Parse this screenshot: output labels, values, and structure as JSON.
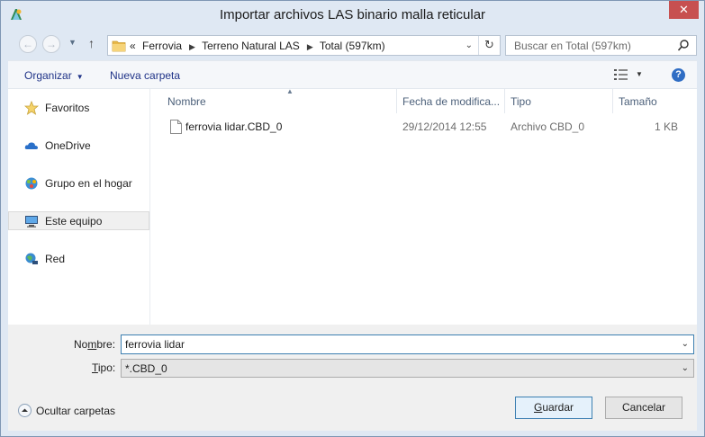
{
  "window": {
    "title": "Importar archivos LAS binario malla reticular",
    "close_symbol": "✕"
  },
  "navbar": {
    "back_symbol": "←",
    "forward_symbol": "→",
    "up_symbol": "↑",
    "breadcrumb_prefix": "«",
    "breadcrumbs": [
      "Ferrovia",
      "Terreno Natural LAS",
      "Total (597km)"
    ],
    "refresh_symbol": "↻"
  },
  "search": {
    "placeholder": "Buscar en Total (597km)"
  },
  "toolbar": {
    "organize_label": "Organizar",
    "new_folder_label": "Nueva carpeta",
    "help_symbol": "?"
  },
  "sidebar": {
    "items": [
      {
        "label": "Favoritos",
        "icon": "star-icon"
      },
      {
        "label": "OneDrive",
        "icon": "cloud-icon"
      },
      {
        "label": "Grupo en el hogar",
        "icon": "homegroup-icon"
      },
      {
        "label": "Este equipo",
        "icon": "computer-icon",
        "selected": true
      },
      {
        "label": "Red",
        "icon": "network-icon"
      }
    ]
  },
  "file_list": {
    "columns": [
      "Nombre",
      "Fecha de modifica...",
      "Tipo",
      "Tamaño"
    ],
    "rows": [
      {
        "name": "ferrovia lidar.CBD_0",
        "modified": "29/12/2014 12:55",
        "type": "Archivo CBD_0",
        "size": "1 KB"
      }
    ]
  },
  "form": {
    "name_label_pre": "No",
    "name_label_key": "m",
    "name_label_post": "bre:",
    "name_value": "ferrovia lidar",
    "type_label_key": "T",
    "type_label_post": "ipo:",
    "type_value": "*.CBD_0",
    "hide_folders_label": "Ocultar carpetas",
    "save_key": "G",
    "save_post": "uardar",
    "cancel_label": "Cancelar"
  },
  "colors": {
    "accent": "#3c7fb1",
    "close": "#c75050",
    "link": "#1e3287"
  }
}
